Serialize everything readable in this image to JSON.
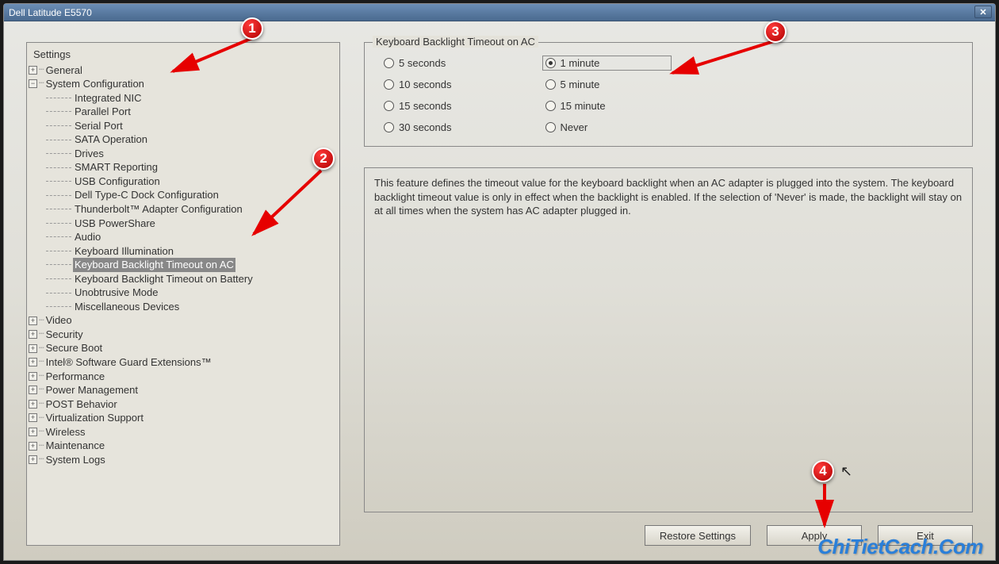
{
  "window": {
    "title": "Dell Latitude E5570"
  },
  "tree": {
    "title": "Settings",
    "nodes": [
      {
        "label": "General",
        "exp": "+"
      },
      {
        "label": "System Configuration",
        "exp": "-",
        "children": [
          "Integrated NIC",
          "Parallel Port",
          "Serial Port",
          "SATA Operation",
          "Drives",
          "SMART Reporting",
          "USB Configuration",
          "Dell Type-C Dock Configuration",
          "Thunderbolt™ Adapter Configuration",
          "USB PowerShare",
          "Audio",
          "Keyboard Illumination",
          "Keyboard Backlight Timeout on AC",
          "Keyboard Backlight Timeout on Battery",
          "Unobtrusive Mode",
          "Miscellaneous Devices"
        ],
        "selected_index": 12
      },
      {
        "label": "Video",
        "exp": "+"
      },
      {
        "label": "Security",
        "exp": "+"
      },
      {
        "label": "Secure Boot",
        "exp": "+"
      },
      {
        "label": "Intel® Software Guard Extensions™",
        "exp": "+"
      },
      {
        "label": "Performance",
        "exp": "+"
      },
      {
        "label": "Power Management",
        "exp": "+"
      },
      {
        "label": "POST Behavior",
        "exp": "+"
      },
      {
        "label": "Virtualization Support",
        "exp": "+"
      },
      {
        "label": "Wireless",
        "exp": "+"
      },
      {
        "label": "Maintenance",
        "exp": "+"
      },
      {
        "label": "System Logs",
        "exp": "+"
      }
    ]
  },
  "panel": {
    "legend": "Keyboard Backlight Timeout on AC",
    "col1": [
      "5 seconds",
      "10 seconds",
      "15 seconds",
      "30 seconds"
    ],
    "col2": [
      "1 minute",
      "5 minute",
      "15 minute",
      "Never"
    ],
    "selected": "1 minute",
    "description": "This feature defines the timeout value for the keyboard backlight when an AC adapter is plugged into the system. The keyboard backlight timeout value is only in effect when the backlight is enabled. If the selection of 'Never' is made, the backlight will stay on at all times when the system has AC adapter plugged in."
  },
  "buttons": {
    "restore": "Restore Settings",
    "apply": "Apply",
    "exit": "Exit"
  },
  "markers": {
    "m1": "1",
    "m2": "2",
    "m3": "3",
    "m4": "4"
  },
  "watermark": "ChiTietCach.Com"
}
